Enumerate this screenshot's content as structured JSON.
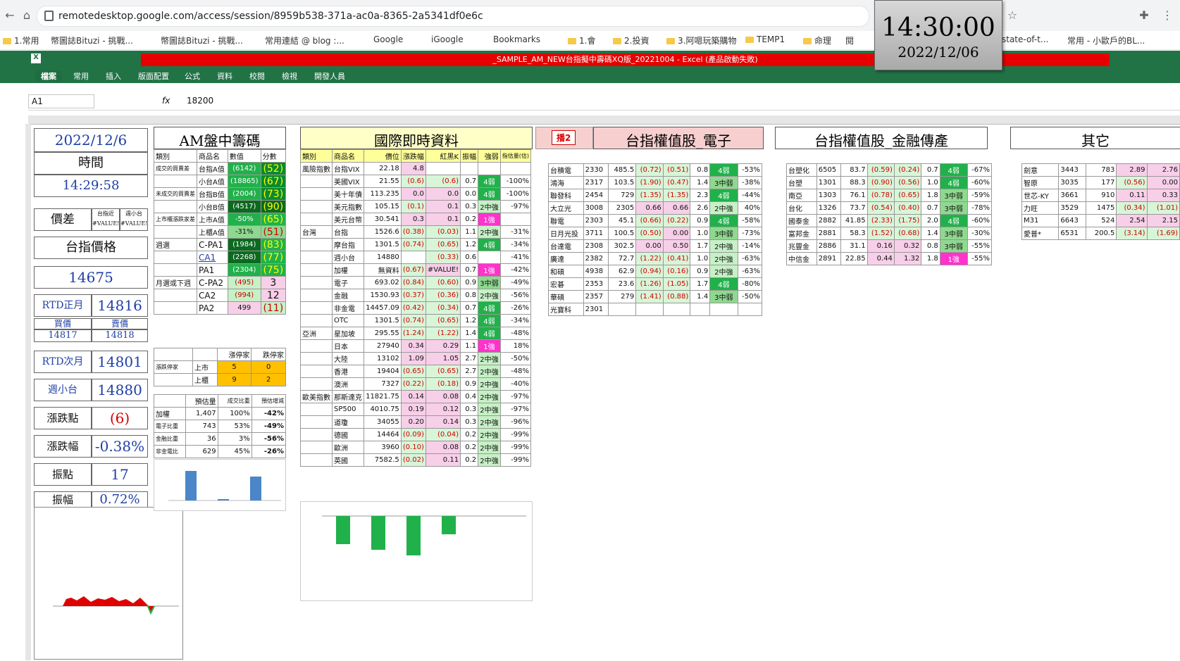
{
  "browser": {
    "url": "remotedesktop.google.com/access/session/8959b538-371a-ac0a-8365-2a5341df0e6c",
    "bookmarks": [
      "1.常用",
      "幣圖誌Bituzi - 挑戰...",
      "幣圖誌Bituzi - 挑戰...",
      "常用連結 @ blog :...",
      "Google",
      "iGoogle",
      "Bookmarks",
      "1.會",
      "2.投資",
      "3.阿嗯玩築購物",
      "TEMP1",
      "命理",
      "閱",
      "state-of-t...",
      "常用 - 小歐戶的BL..."
    ]
  },
  "clock": {
    "time": "14:30:00",
    "date": "2022/12/06"
  },
  "excel": {
    "title": "_SAMPLE_AM_NEW台指擬中壽碼XQ版_20221004 - Excel (產品啟動失敗)",
    "tabs": [
      "檔案",
      "常用",
      "插入",
      "版面配置",
      "公式",
      "資料",
      "校閱",
      "檢視",
      "開發人員"
    ],
    "name_box": "A1",
    "formula_value": "18200"
  },
  "left": {
    "date": "2022/12/6",
    "time_label": "時間",
    "time": "14:29:58",
    "spread_label": "價差",
    "spread_a": "台指近",
    "spread_b": "週小台",
    "spread_err": "#VALUE!",
    "taiex_label": "台指價格",
    "taiex": "14675",
    "rtd_main_label": "RTD正月",
    "rtd_main": "14816",
    "bid_label": "買價",
    "ask_label": "賣價",
    "bid": "14817",
    "ask": "14818",
    "rtd_next_label": "RTD次月",
    "rtd_next": "14801",
    "weekly_label": "週小台",
    "weekly": "14880",
    "chg_pts_label": "漲跌點",
    "chg_pts": "(6)",
    "chg_pct_label": "漲跌幅",
    "chg_pct": "-0.38%",
    "amp_label": "振點",
    "amp": "17",
    "amp_pct_label": "振幅",
    "amp_pct": "0.72%"
  },
  "am": {
    "title": "AM盤中籌碼",
    "headers": [
      "類別",
      "商品名",
      "數值",
      "分數"
    ],
    "rows": [
      [
        "成交的買賣差",
        "台指A值",
        "(6142)",
        "(52)"
      ],
      [
        "",
        "小台A值",
        "(18865)",
        "(67)"
      ],
      [
        "未成交的買賣差",
        "台指B值",
        "(2004)",
        "(73)"
      ],
      [
        "",
        "小台B值",
        "(4517)",
        "(90)"
      ],
      [
        "上市櫃漲跌家差",
        "上市A值",
        "-50%",
        "(65)"
      ],
      [
        "",
        "上櫃A值",
        "-31%",
        "(51)"
      ],
      [
        "週選",
        "C-PA1",
        "(1984)",
        "(83)"
      ],
      [
        "",
        "CA1",
        "(2268)",
        "(77)"
      ],
      [
        "",
        "PA1",
        "(2304)",
        "(75)"
      ],
      [
        "月選或下週",
        "C-PA2",
        "(495)",
        "3"
      ],
      [
        "",
        "CA2",
        "(994)",
        "12"
      ],
      [
        "",
        "PA2",
        "499",
        "(11)"
      ]
    ],
    "breadth_headers": [
      "漲停家",
      "跌停家"
    ],
    "breadth": [
      [
        "上市",
        "5",
        "0"
      ],
      [
        "上櫃",
        "9",
        "2"
      ]
    ],
    "breadth_label": "漲跌停家",
    "vol_headers": [
      "預估量",
      "成交比重",
      "預估增減"
    ],
    "vol": [
      [
        "加權",
        "1,407",
        "100%",
        "-42%"
      ],
      [
        "電子比重",
        "743",
        "53%",
        "-49%"
      ],
      [
        "金融比重",
        "36",
        "3%",
        "-56%"
      ],
      [
        "非金電比",
        "629",
        "45%",
        "-26%"
      ]
    ]
  },
  "intl": {
    "title": "國際即時資料",
    "headers": [
      "類別",
      "商品名",
      "價位",
      "漲跌幅",
      "紅黑K",
      "振幅",
      "強弱",
      "指估量(估)"
    ],
    "rows": [
      [
        "風險指數",
        "台指VIX",
        "22.18",
        "4.8",
        "",
        "",
        "",
        ""
      ],
      [
        "",
        "美國VIX",
        "21.55",
        "(0.6)",
        "(0.6)",
        "0.7",
        "4弱",
        "-100%"
      ],
      [
        "",
        "美十年債",
        "113.235",
        "0.0",
        "0.0",
        "0.0",
        "4弱",
        "-100%"
      ],
      [
        "",
        "美元指數",
        "105.15",
        "(0.1)",
        "0.1",
        "0.3",
        "2中強",
        "-97%"
      ],
      [
        "",
        "美元台幣",
        "30.541",
        "0.3",
        "0.1",
        "0.2",
        "1強",
        ""
      ],
      [
        "台灣",
        "台指",
        "1526.6",
        "(0.38)",
        "(0.03)",
        "1.1",
        "2中強",
        "-31%"
      ],
      [
        "",
        "摩台指",
        "1301.5",
        "(0.74)",
        "(0.65)",
        "1.2",
        "4弱",
        "-34%"
      ],
      [
        "",
        "週小台",
        "14880",
        "",
        "(0.33)",
        "0.6",
        "",
        "-41%"
      ],
      [
        "",
        "加權",
        "無資料",
        "(0.67)",
        "#VALUE!",
        "0.7",
        "1強",
        "-42%"
      ],
      [
        "",
        "電子",
        "693.02",
        "(0.84)",
        "(0.60)",
        "0.9",
        "3中弱",
        "-49%"
      ],
      [
        "",
        "金融",
        "1530.93",
        "(0.37)",
        "(0.36)",
        "0.8",
        "2中強",
        "-56%"
      ],
      [
        "",
        "非金電",
        "14457.09",
        "(0.42)",
        "(0.34)",
        "0.7",
        "4弱",
        "-26%"
      ],
      [
        "",
        "OTC",
        "1301.5",
        "(0.74)",
        "(0.65)",
        "1.2",
        "4弱",
        "-34%"
      ],
      [
        "亞洲",
        "星加坡",
        "295.55",
        "(1.24)",
        "(1.22)",
        "1.4",
        "4弱",
        "-48%"
      ],
      [
        "",
        "日本",
        "27940",
        "0.34",
        "0.29",
        "1.1",
        "1強",
        "18%"
      ],
      [
        "",
        "大陸",
        "13102",
        "1.09",
        "1.05",
        "2.7",
        "2中強",
        "-50%"
      ],
      [
        "",
        "香港",
        "19404",
        "(0.65)",
        "(0.65)",
        "2.7",
        "2中強",
        "-48%"
      ],
      [
        "",
        "澳洲",
        "7327",
        "(0.22)",
        "(0.18)",
        "0.9",
        "2中強",
        "-40%"
      ],
      [
        "歐美指數",
        "那斯達克",
        "11821.75",
        "0.14",
        "0.08",
        "0.4",
        "2中強",
        "-97%"
      ],
      [
        "",
        "SP500",
        "4010.75",
        "0.19",
        "0.12",
        "0.3",
        "2中強",
        "-97%"
      ],
      [
        "",
        "道瓊",
        "34055",
        "0.20",
        "0.14",
        "0.3",
        "2中強",
        "-96%"
      ],
      [
        "",
        "德國",
        "14464",
        "(0.09)",
        "(0.04)",
        "0.2",
        "2中強",
        "-99%"
      ],
      [
        "",
        "歐洲",
        "3960",
        "(0.10)",
        "0.08",
        "0.2",
        "2中強",
        "-99%"
      ],
      [
        "",
        "英國",
        "7582.5",
        "(0.02)",
        "0.11",
        "0.2",
        "2中強",
        "-99%"
      ]
    ]
  },
  "elec": {
    "button": "播2",
    "title": "台指權值股_電子",
    "rows": [
      [
        "台積電",
        "2330",
        "485.5",
        "(0.72)",
        "(0.51)",
        "0.8",
        "4弱",
        "-53%"
      ],
      [
        "鴻海",
        "2317",
        "103.5",
        "(1.90)",
        "(0.47)",
        "1.4",
        "3中弱",
        "-38%"
      ],
      [
        "聯發科",
        "2454",
        "729",
        "(1.35)",
        "(1.35)",
        "2.3",
        "4弱",
        "-44%"
      ],
      [
        "大立光",
        "3008",
        "2305",
        "0.66",
        "0.66",
        "2.6",
        "2中強",
        "40%"
      ],
      [
        "聯電",
        "2303",
        "45.1",
        "(0.66)",
        "(0.22)",
        "0.9",
        "4弱",
        "-58%"
      ],
      [
        "日月光投",
        "3711",
        "100.5",
        "(0.50)",
        "0.00",
        "1.0",
        "3中弱",
        "-73%"
      ],
      [
        "台達電",
        "2308",
        "302.5",
        "0.00",
        "0.50",
        "1.7",
        "2中強",
        "-14%"
      ],
      [
        "廣達",
        "2382",
        "72.7",
        "(1.22)",
        "(0.41)",
        "1.0",
        "2中強",
        "-63%"
      ],
      [
        "和碩",
        "4938",
        "62.9",
        "(0.94)",
        "(0.16)",
        "0.9",
        "2中強",
        "-63%"
      ],
      [
        "宏碁",
        "2353",
        "23.6",
        "(1.26)",
        "(1.05)",
        "1.7",
        "4弱",
        "-80%"
      ],
      [
        "華碩",
        "2357",
        "279",
        "(1.41)",
        "(0.88)",
        "1.4",
        "3中弱",
        "-50%"
      ],
      [
        "光寶科",
        "2301",
        "",
        "",
        "",
        "",
        "",
        ""
      ]
    ]
  },
  "fin": {
    "title": "台指權值股_金融傳產",
    "rows": [
      [
        "台塑化",
        "6505",
        "83.7",
        "(0.59)",
        "(0.24)",
        "0.7",
        "4弱",
        "-67%"
      ],
      [
        "台塑",
        "1301",
        "88.3",
        "(0.90)",
        "(0.56)",
        "1.0",
        "4弱",
        "-60%"
      ],
      [
        "南亞",
        "1303",
        "76.1",
        "(0.78)",
        "(0.65)",
        "1.8",
        "3中弱",
        "-59%"
      ],
      [
        "台化",
        "1326",
        "73.7",
        "(0.54)",
        "(0.40)",
        "0.7",
        "3中弱",
        "-78%"
      ],
      [
        "國泰金",
        "2882",
        "41.85",
        "(2.33)",
        "(1.75)",
        "2.0",
        "4弱",
        "-60%"
      ],
      [
        "富邦金",
        "2881",
        "58.3",
        "(1.52)",
        "(0.68)",
        "1.4",
        "3中弱",
        "-30%"
      ],
      [
        "兆豐金",
        "2886",
        "31.1",
        "0.16",
        "0.32",
        "0.8",
        "3中弱",
        "-55%"
      ],
      [
        "中信金",
        "2891",
        "22.85",
        "0.44",
        "1.32",
        "1.8",
        "1強",
        "-55%"
      ]
    ]
  },
  "other": {
    "title": "其它",
    "rows": [
      [
        "劍意",
        "3443",
        "783",
        "2.89",
        "2.76"
      ],
      [
        "智原",
        "3035",
        "177",
        "(0.56)",
        "0.00"
      ],
      [
        "世芯-KY",
        "3661",
        "910",
        "0.11",
        "0.33"
      ],
      [
        "力旺",
        "3529",
        "1475",
        "(0.34)",
        "(1.01)"
      ],
      [
        "M31",
        "6643",
        "524",
        "2.54",
        "2.15"
      ],
      [
        "愛普*",
        "6531",
        "200.5",
        "(3.14)",
        "(1.69)"
      ]
    ]
  }
}
